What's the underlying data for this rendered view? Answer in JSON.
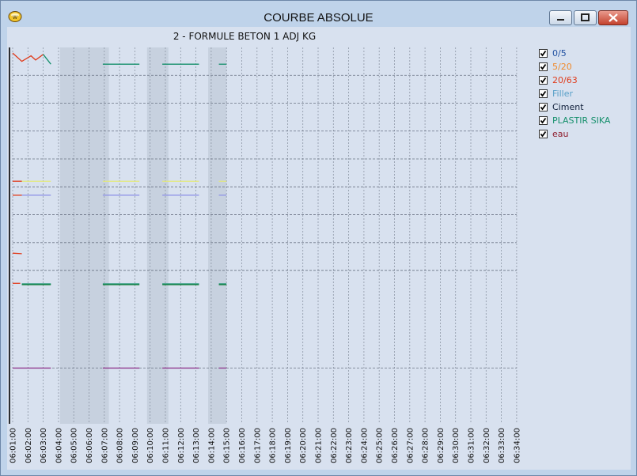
{
  "window": {
    "title": "COURBE ABSOLUE",
    "icons": {
      "app": "concrete-mixer-icon",
      "minimize": "minimize-icon",
      "maximize": "maximize-icon",
      "close": "close-icon"
    }
  },
  "chart_data": {
    "type": "line",
    "title": "2 - FORMULE BETON 1 ADJ KG",
    "xlabel": "",
    "ylabel": "",
    "grid": true,
    "legend_position": "right",
    "categories": [
      "06:01:00",
      "06:02:00",
      "06:03:00",
      "06:04:00",
      "06:05:00",
      "06:06:00",
      "06:07:00",
      "06:08:00",
      "06:09:00",
      "06:10:00",
      "06:11:00",
      "06:12:00",
      "06:13:00",
      "06:14:00",
      "06:15:00",
      "06:16:00",
      "06:17:00",
      "06:18:00",
      "06:19:00",
      "06:20:00",
      "06:21:00",
      "06:22:00",
      "06:23:00",
      "06:24:00",
      "06:25:00",
      "06:26:00",
      "06:27:00",
      "06:28:00",
      "06:29:00",
      "06:30:00",
      "06:31:00",
      "06:32:00",
      "06:33:00",
      "06:34:00"
    ],
    "shaded_ranges": [
      [
        3.1,
        6.3
      ],
      [
        8.8,
        10.2
      ],
      [
        12.8,
        14.0
      ]
    ],
    "series": [
      {
        "name": "0/5",
        "color": "#1f4fa0",
        "checked": true,
        "segments": []
      },
      {
        "name": "5/20",
        "color": "#f0892a",
        "checked": true,
        "segments": []
      },
      {
        "name": "20/63",
        "color": "#e03c1c",
        "checked": true,
        "segments": [
          [
            [
              0,
              8.3
            ],
            [
              0.6,
              8.0
            ],
            [
              1.2,
              8.2
            ],
            [
              1.5,
              8.05
            ],
            [
              2.0,
              8.25
            ]
          ],
          [
            [
              0,
              1.12
            ],
            [
              0.6,
              1.1
            ]
          ],
          [
            [
              0,
              0.04
            ],
            [
              0.5,
              0.04
            ]
          ],
          [
            [
              0,
              3.7
            ],
            [
              0.6,
              3.7
            ]
          ],
          [
            [
              0,
              3.2
            ],
            [
              0.6,
              3.2
            ]
          ]
        ]
      },
      {
        "name": "Filler",
        "color": "#58a0c8",
        "checked": true,
        "segments": []
      },
      {
        "name": "Ciment",
        "color": "#101f3a",
        "checked": true,
        "segments": []
      },
      {
        "name": "PLASTIR SIKA",
        "color": "#16906c",
        "checked": true,
        "segments": [
          [
            [
              2.0,
              8.25
            ],
            [
              2.5,
              7.9
            ]
          ],
          [
            [
              5.9,
              7.9
            ],
            [
              8.3,
              7.9
            ]
          ],
          [
            [
              9.8,
              7.9
            ],
            [
              12.2,
              7.9
            ]
          ],
          [
            [
              13.5,
              7.9
            ],
            [
              14.0,
              7.9
            ]
          ],
          [
            [
              0.6,
              0.02
            ],
            [
              2.5,
              0.02
            ]
          ],
          [
            [
              5.9,
              0.02
            ],
            [
              8.3,
              0.02
            ]
          ],
          [
            [
              9.8,
              0.02
            ],
            [
              12.2,
              0.02
            ]
          ],
          [
            [
              13.5,
              0.02
            ],
            [
              14.0,
              0.02
            ]
          ]
        ]
      },
      {
        "name": "eau",
        "color": "#8e1c2c",
        "checked": true,
        "segments": []
      }
    ],
    "extra_lines": [
      {
        "color": "#e3e87a",
        "value": 3.7,
        "ranges": [
          [
            0.6,
            2.5
          ],
          [
            5.9,
            8.3
          ],
          [
            9.8,
            12.2
          ],
          [
            13.5,
            14.0
          ]
        ]
      },
      {
        "color": "#8c90e6",
        "value": 3.2,
        "ranges": [
          [
            0.6,
            2.5
          ],
          [
            5.9,
            8.3
          ],
          [
            9.8,
            12.2
          ],
          [
            13.5,
            14.0
          ]
        ]
      },
      {
        "color": "#127a2e",
        "value": -0.01,
        "ranges": [
          [
            0.6,
            2.5
          ],
          [
            5.9,
            8.3
          ],
          [
            9.8,
            12.2
          ],
          [
            13.5,
            14.0
          ]
        ]
      },
      {
        "color": "#8a2a86",
        "value": -3.0,
        "ranges": [
          [
            0,
            2.5
          ],
          [
            5.9,
            8.3
          ],
          [
            9.8,
            12.2
          ],
          [
            13.5,
            14.0
          ]
        ]
      }
    ],
    "ylim": [
      -5,
      8.5
    ],
    "y_grid": [
      7.5,
      6.5,
      5.5,
      4.5,
      3.5,
      2.5,
      1.5,
      0.5,
      -3.0
    ]
  }
}
